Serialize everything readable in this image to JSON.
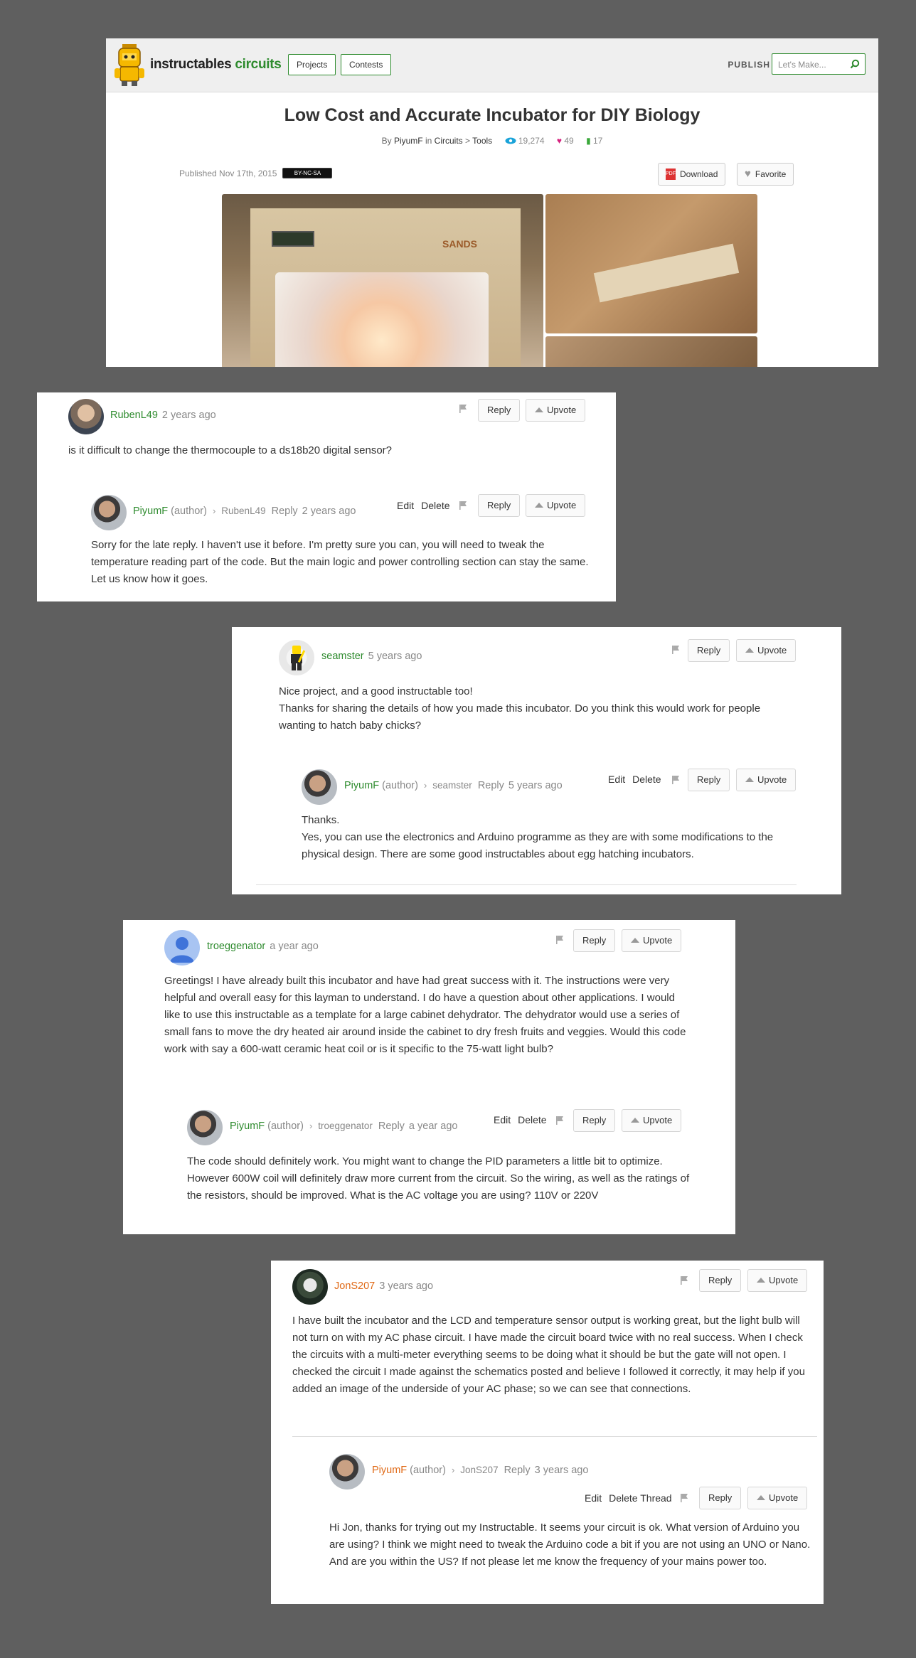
{
  "header": {
    "brand_main": "instructables",
    "brand_accent": "circuits",
    "nav": [
      "Projects",
      "Contests"
    ],
    "publish": "PUBLISH",
    "search_placeholder": "Let's Make..."
  },
  "project": {
    "title": "Low Cost and Accurate Incubator for DIY Biology",
    "by": "By",
    "author": "PiyumF",
    "in": "in",
    "category": "Circuits",
    "sep": ">",
    "subcategory": "Tools",
    "views": "19,274",
    "favorites": "49",
    "comments": "17",
    "published": "Published Nov 17th, 2015",
    "license": "BY-NC-SA",
    "download_label": "Download",
    "favorite_label": "Favorite",
    "photo_brand": "SANDS"
  },
  "labels": {
    "reply": "Reply",
    "upvote": "Upvote",
    "edit": "Edit",
    "delete": "Delete",
    "delete_thread": "Delete Thread",
    "author_tag": "(author)",
    "reply_word": "Reply"
  },
  "threads": [
    {
      "user": "RubenL49",
      "time": "2 years ago",
      "text": "is it difficult to change the thermocouple to a ds18b20 digital sensor?",
      "reply": {
        "user": "PiyumF",
        "to": "RubenL49",
        "time": "2 years ago",
        "text": "Sorry for the late reply. I haven't use it before. I'm pretty sure you can, you will need to tweak the temperature reading part of the code. But the main logic and power controlling section can stay the same. Let us know how it goes."
      }
    },
    {
      "user": "seamster",
      "time": "5 years ago",
      "text_lines": [
        "Nice project, and a good instructable too!",
        "Thanks for sharing the details of how you made this incubator. Do you think this would work for people wanting to hatch baby chicks?"
      ],
      "reply": {
        "user": "PiyumF",
        "to": "seamster",
        "time": "5 years ago",
        "text_lines": [
          "Thanks.",
          "Yes, you can use the electronics and Arduino programme as they are with some modifications to the physical design. There are some good instructables about egg hatching incubators."
        ]
      }
    },
    {
      "user": "troeggenator",
      "time": "a year ago",
      "text": "Greetings! I have already built this incubator and have had great success with it. The instructions were very helpful and overall easy for this layman to understand. I do have a question about other applications. I would like to use this instructable as a template for a large cabinet dehydrator. The dehydrator would use a series of small fans to move the dry heated air around inside the cabinet to dry fresh fruits and veggies. Would this code work with say a 600-watt ceramic heat coil or is it specific to the 75-watt light bulb?",
      "reply": {
        "user": "PiyumF",
        "to": "troeggenator",
        "time": "a year ago",
        "text_lines": [
          "The code should definitely work. You might want to change the PID parameters a little bit to optimize.",
          "However 600W coil will definitely draw more current from the circuit. So the wiring, as well as the ratings of the resistors, should be improved. What is the AC voltage you are using? 110V or 220V"
        ]
      }
    },
    {
      "user": "JonS207",
      "time": "3 years ago",
      "text": "I have built the incubator and the LCD and temperature sensor output is working great, but the light bulb will not turn on with my AC phase circuit. I have made the circuit board twice with no real success. When I check the circuits with a multi-meter everything seems to be doing what it should be but the gate will not open. I checked the circuit I made against the schematics posted and believe I followed it correctly, it may help if you added an image of the underside of your AC phase; so we can see that connections.",
      "reply": {
        "user": "PiyumF",
        "to": "JonS207",
        "time": "3 years ago",
        "text": "Hi Jon, thanks for trying out my Instructable. It seems your circuit is ok. What version of Arduino you are using? I think we might need to tweak the Arduino code a bit if you are not using an UNO or Nano. And are you within the US? If not please let me know the frequency of your mains power too."
      }
    }
  ],
  "colors": {
    "green": "#2e8b2e",
    "orange": "#e06a17",
    "backdrop": "#5f5f5f"
  }
}
